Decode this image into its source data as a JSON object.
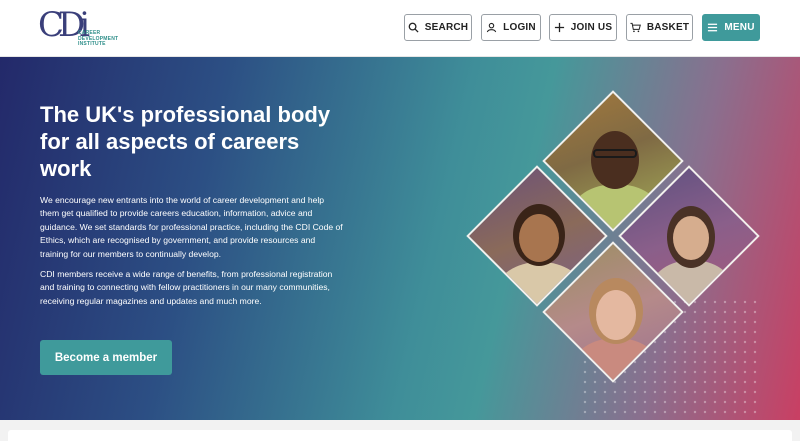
{
  "logo": {
    "mark": "CDi",
    "subtitle": "CAREER\nDEVELOPMENT\nINSTITUTE"
  },
  "nav": {
    "search": "SEARCH",
    "login": "LOGIN",
    "join": "JOIN US",
    "basket": "BASKET",
    "menu": "MENU"
  },
  "hero": {
    "title": "The UK's professional body for all aspects of careers work",
    "paragraph1": "We encourage new entrants into the world of career development and help them get qualified to provide careers education, information, advice and guidance. We set standards for professional practice, including the CDI Code of Ethics, which are recognised by government, and provide resources and training for our members to continually develop.",
    "paragraph2": "CDI members receive a wide range of benefits, from professional registration and training to connecting with fellow practitioners in our many communities, receiving regular magazines and updates and much more.",
    "cta": "Become a member"
  },
  "colors": {
    "accent": "#3f9a9b",
    "brand_navy": "#3a3f7a",
    "gradient_start": "#23296a",
    "gradient_end": "#c93f63"
  },
  "icons": {
    "search": "search-icon",
    "login": "user-icon",
    "join": "plus-icon",
    "basket": "basket-icon",
    "menu": "hamburger-icon"
  }
}
